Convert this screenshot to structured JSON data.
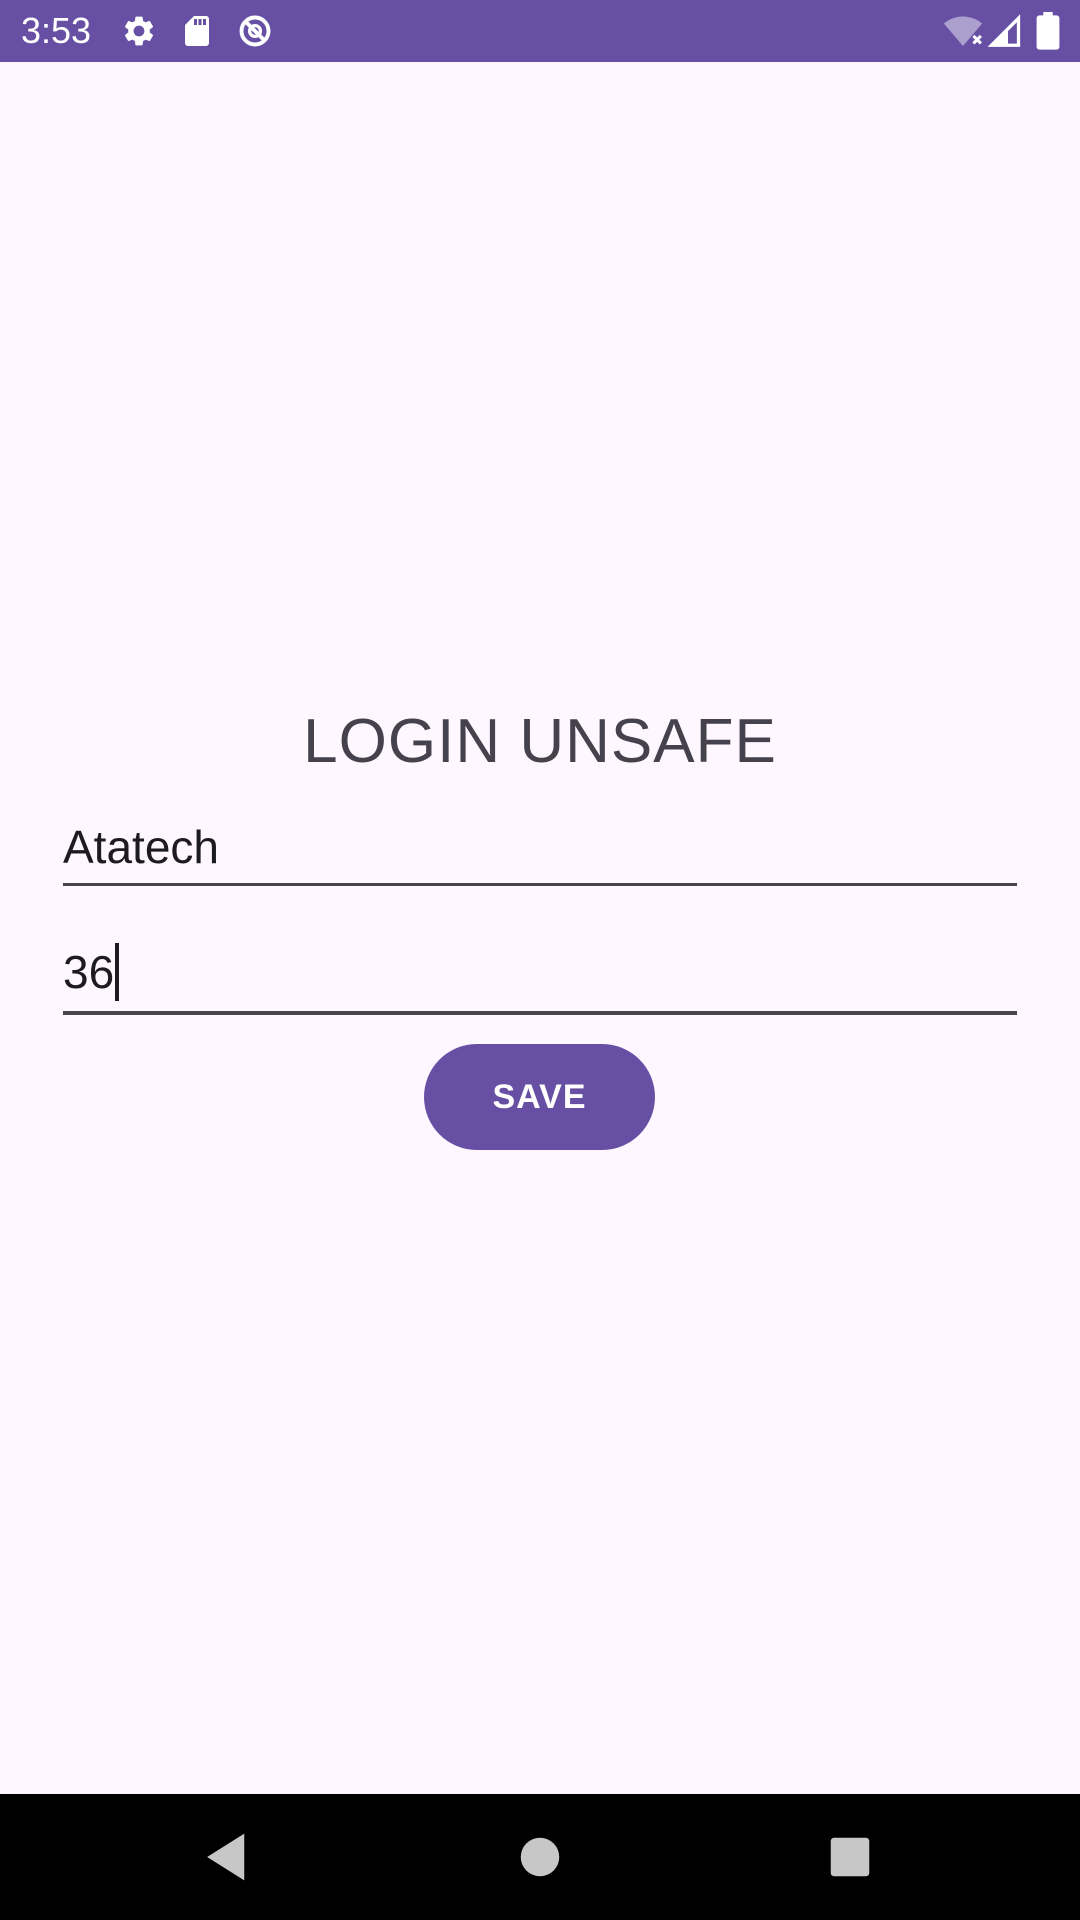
{
  "status_bar": {
    "time": "3:53",
    "background_color": "#6750A4",
    "left_icons": [
      "settings-gear-icon",
      "sd-card-icon",
      "no-entry-circle-icon"
    ],
    "right_icons": [
      "wifi-off-icon",
      "cell-signal-icon",
      "battery-full-icon"
    ]
  },
  "main": {
    "title": "LOGIN UNSAFE",
    "username_value": "Atatech",
    "password_value": "36",
    "save_label": "SAVE"
  },
  "nav_bar": {
    "icons": [
      "back-triangle-icon",
      "home-circle-icon",
      "recents-square-icon"
    ]
  },
  "colors": {
    "accent": "#6750A4",
    "background": "#FEF7FF",
    "title_text": "#45424E",
    "field_text": "#1D1B20",
    "underline": "#49454F"
  }
}
